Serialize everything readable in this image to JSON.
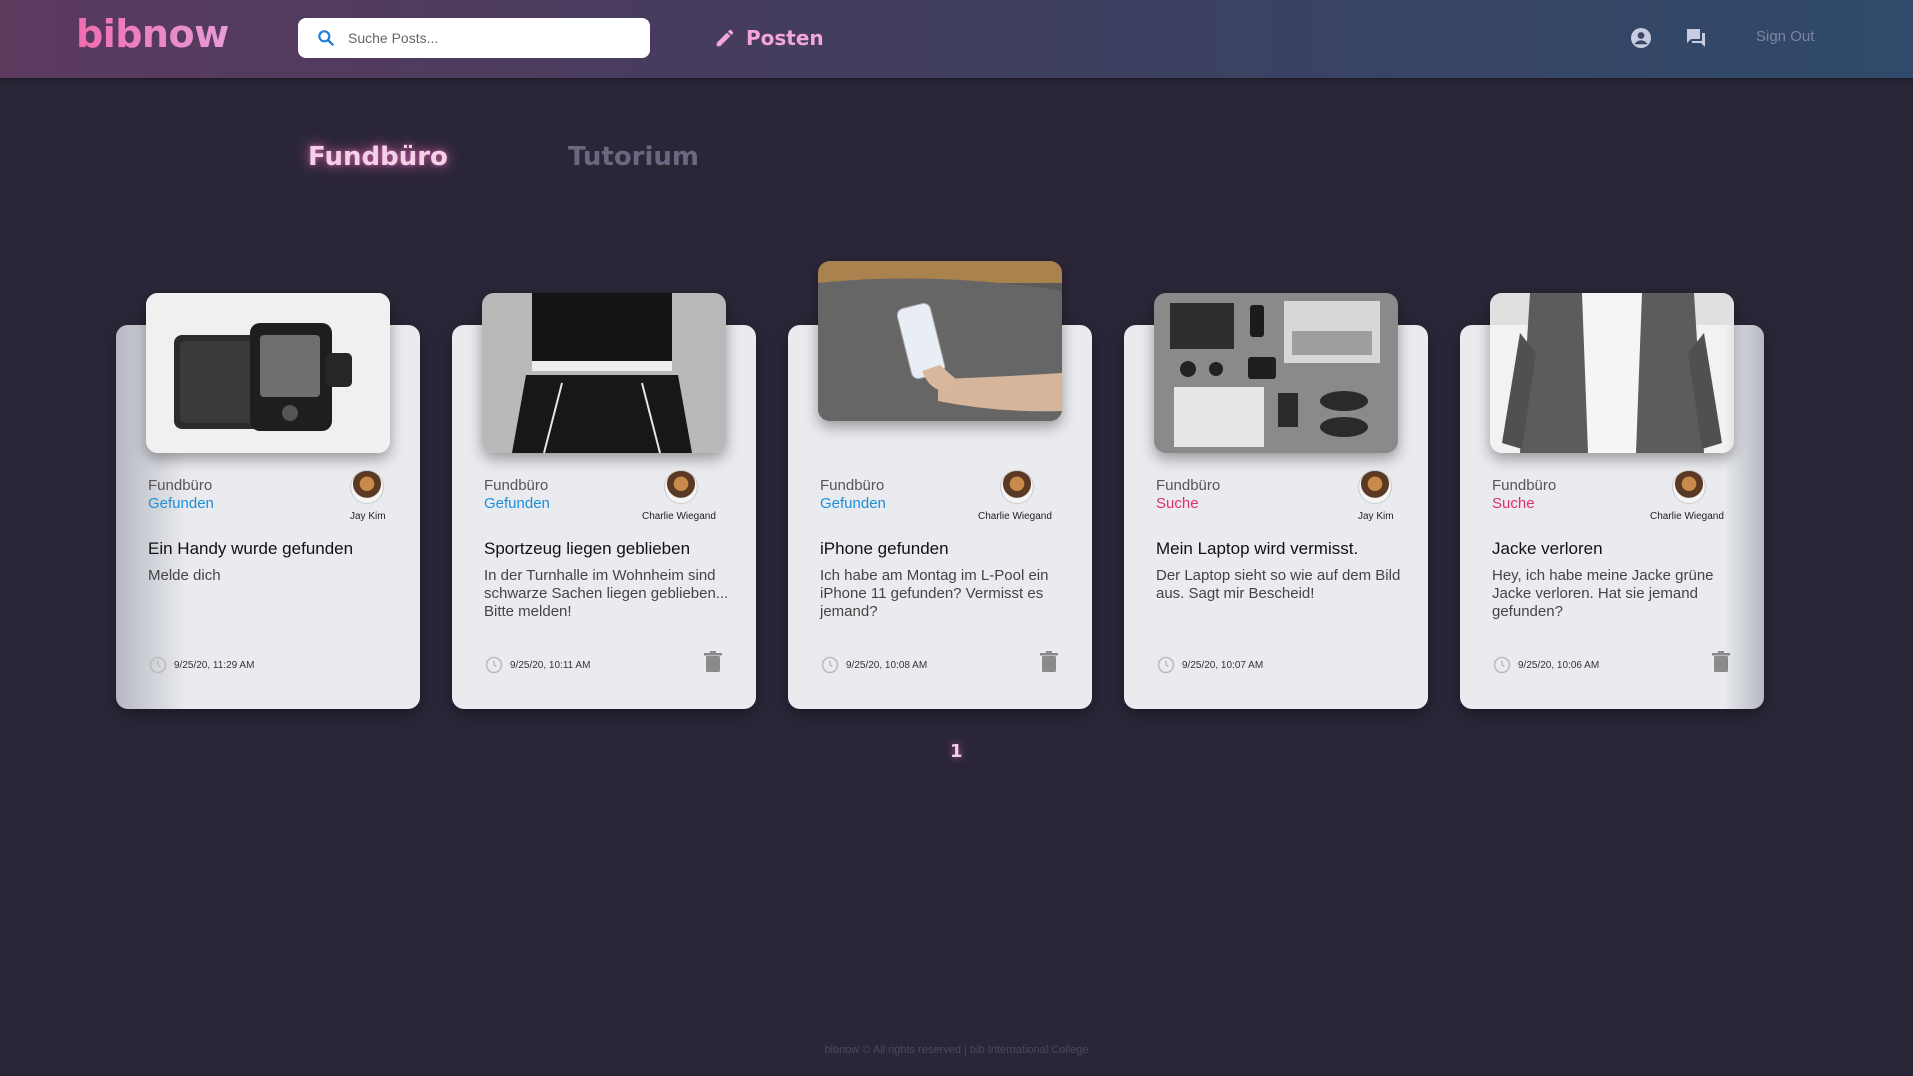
{
  "header": {
    "logo": "bibnow",
    "search_placeholder": "Suche Posts...",
    "post_label": "Posten",
    "signout_label": "Sign Out"
  },
  "tabs": [
    {
      "label": "Fundbüro",
      "active": true
    },
    {
      "label": "Tutorium",
      "active": false
    }
  ],
  "cards": [
    {
      "category": "Fundbüro",
      "status": "Gefunden",
      "author": "Jay Kim",
      "title": "Ein Handy wurde gefunden",
      "description": "Melde dich",
      "timestamp": "9/25/20, 11:29 AM",
      "image": "wallet-phone"
    },
    {
      "category": "Fundbüro",
      "status": "Gefunden",
      "author": "Charlie Wiegand",
      "title": "Sportzeug liegen geblieben",
      "description": "In der Turnhalle im Wohnheim sind schwarze Sachen liegen geblieben... Bitte melden!",
      "timestamp": "9/25/20, 10:11 AM",
      "image": "sports-clothes"
    },
    {
      "category": "Fundbüro",
      "status": "Gefunden",
      "author": "Charlie Wiegand",
      "title": "iPhone gefunden",
      "description": "Ich habe am Montag im L-Pool ein iPhone 11 gefunden? Vermisst es jemand?",
      "timestamp": "9/25/20, 10:08 AM",
      "image": "iphone"
    },
    {
      "category": "Fundbüro",
      "status": "Suche",
      "author": "Jay Kim",
      "title": "Mein Laptop wird vermisst.",
      "description": "Der Laptop sieht so wie auf dem Bild aus. Sagt mir Bescheid!",
      "timestamp": "9/25/20, 10:07 AM",
      "image": "laptop-flatlay"
    },
    {
      "category": "Fundbüro",
      "status": "Suche",
      "author": "Charlie Wiegand",
      "title": "Jacke verloren",
      "description": "Hey, ich habe meine Jacke grüne Jacke verloren. Hat sie jemand gefunden?",
      "timestamp": "9/25/20, 10:06 AM",
      "image": "jacket"
    }
  ],
  "pagination": {
    "current": "1"
  },
  "footer": "bibnow © All rights reserved | bib International College",
  "colors": {
    "found": "#1d8fd6",
    "search": "#e0306a",
    "accent": "#f06db0",
    "background": "#2a2638"
  }
}
